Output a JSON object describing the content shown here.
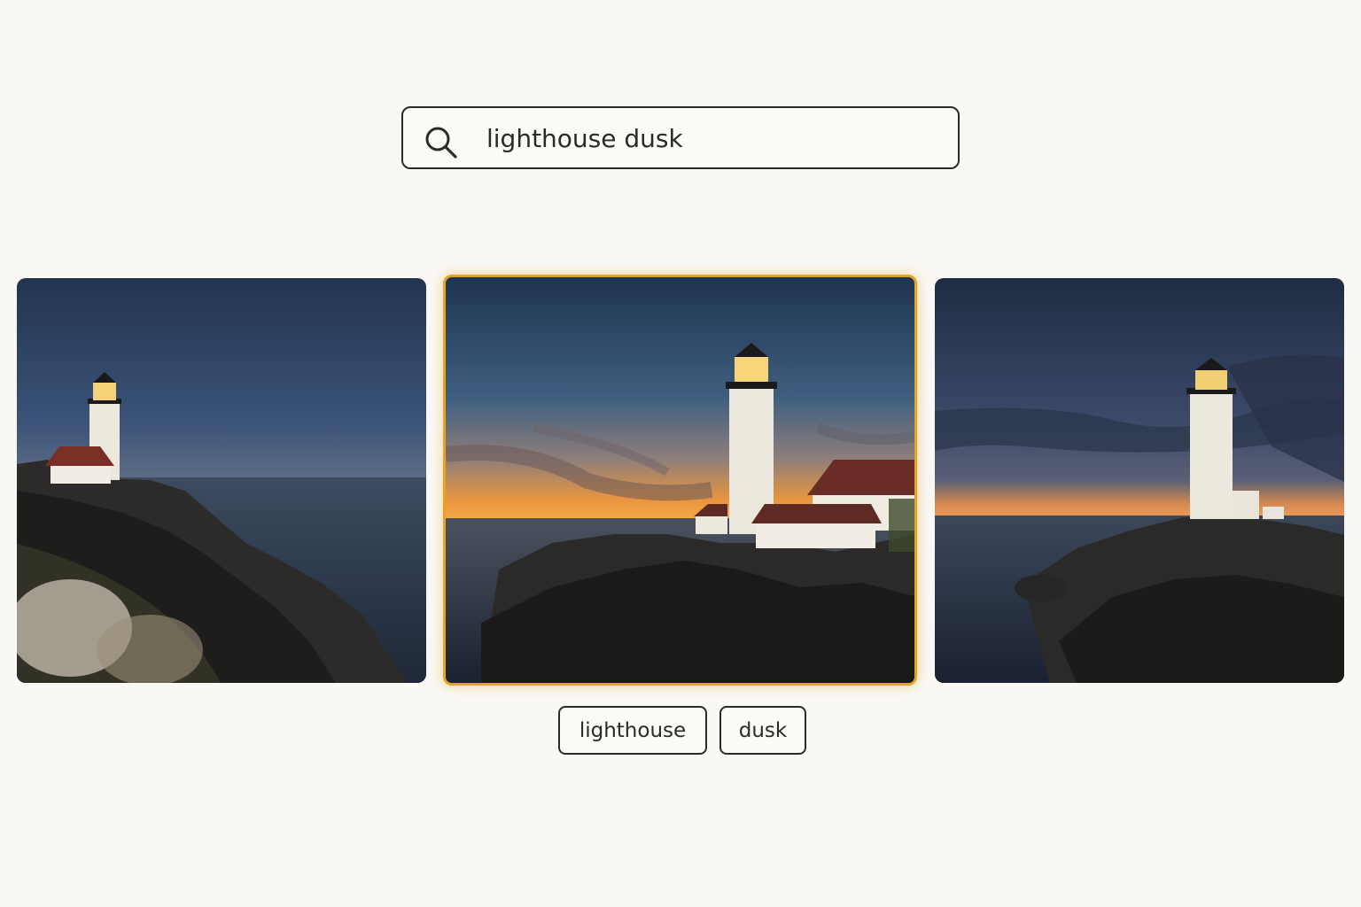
{
  "search": {
    "query": "lighthouse dusk",
    "icon": "search-icon"
  },
  "results": [
    {
      "position": "left",
      "selected": false
    },
    {
      "position": "center",
      "selected": true
    },
    {
      "position": "right",
      "selected": false
    }
  ],
  "tags": [
    {
      "label": "lighthouse"
    },
    {
      "label": "dusk"
    }
  ],
  "colors": {
    "background": "#f9f8f4",
    "border": "#2a2a2a",
    "selected_accent": "#e3a325"
  }
}
